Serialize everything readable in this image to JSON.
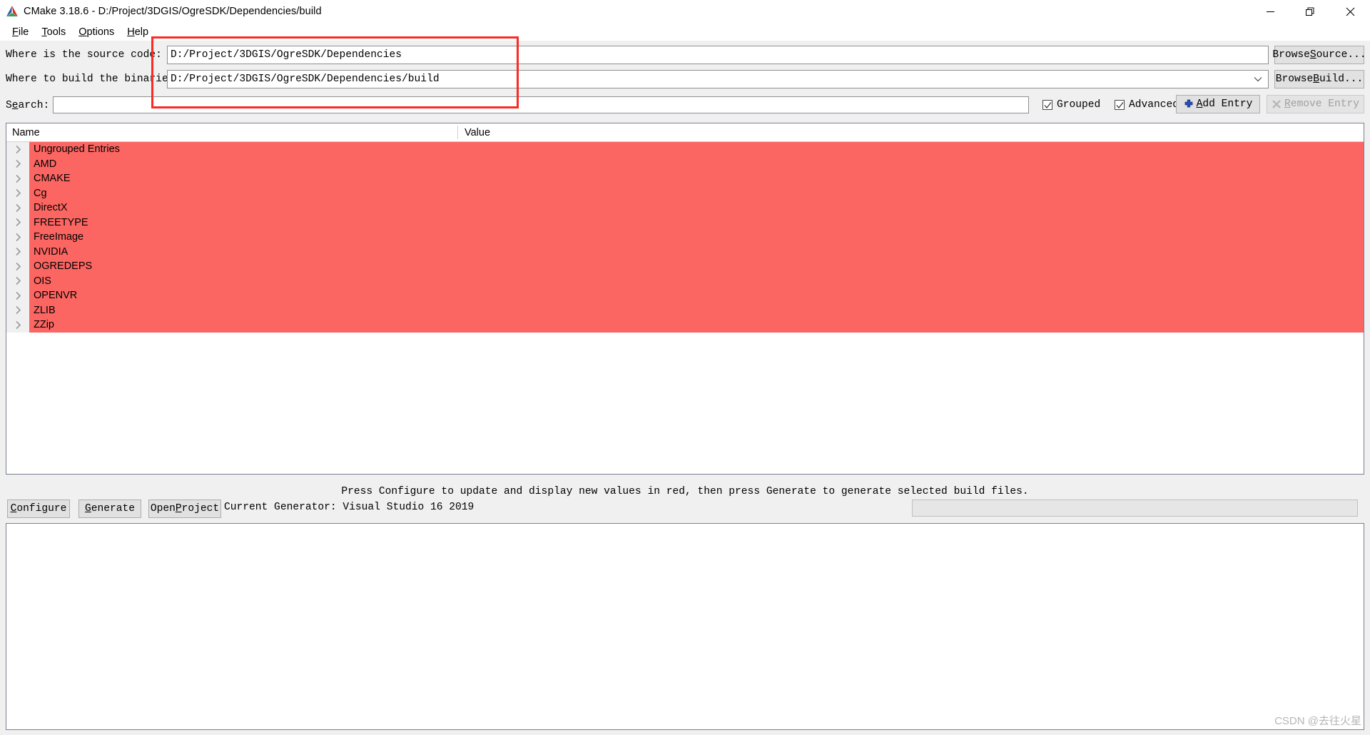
{
  "window": {
    "title": "CMake 3.18.6 - D:/Project/3DGIS/OgreSDK/Dependencies/build",
    "minimize_label": "minimize",
    "restore_label": "restore",
    "close_label": "close"
  },
  "menu": {
    "items": [
      {
        "label": "File",
        "accel": "F",
        "rest": "ile"
      },
      {
        "label": "Tools",
        "accel": "T",
        "rest": "ools"
      },
      {
        "label": "Options",
        "accel": "O",
        "rest": "ptions"
      },
      {
        "label": "Help",
        "accel": "H",
        "rest": "elp"
      }
    ]
  },
  "paths": {
    "source_label": "Where is the source code:",
    "source_value": "D:/Project/3DGIS/OgreSDK/Dependencies",
    "build_label": "Where to build the binaries:",
    "build_value": "D:/Project/3DGIS/OgreSDK/Dependencies/build",
    "browse_source_accel": "S",
    "browse_source_pre": "Browse ",
    "browse_source_post": "ource...",
    "browse_build_accel": "B",
    "browse_build_pre": "Browse ",
    "browse_build_post": "uild..."
  },
  "search": {
    "label_pre": "S",
    "label_accel": "e",
    "label_post": "arch:",
    "value": "",
    "placeholder": ""
  },
  "toolbar": {
    "grouped_label": "Grouped",
    "grouped_checked": true,
    "advanced_label": "Advanced",
    "advanced_checked": true,
    "add_entry_pre": "",
    "add_entry_accel": "A",
    "add_entry_post": "dd Entry",
    "remove_entry_accel": "R",
    "remove_entry_post": "emove Entry",
    "remove_entry_disabled": true
  },
  "tree": {
    "col_name": "Name",
    "col_value": "Value",
    "highlight_color": "#fc6662",
    "rows": [
      {
        "name": "Ungrouped Entries",
        "value": "",
        "expandable": true
      },
      {
        "name": "AMD",
        "value": "",
        "expandable": true
      },
      {
        "name": "CMAKE",
        "value": "",
        "expandable": true
      },
      {
        "name": "Cg",
        "value": "",
        "expandable": true
      },
      {
        "name": "DirectX",
        "value": "",
        "expandable": true
      },
      {
        "name": "FREETYPE",
        "value": "",
        "expandable": true
      },
      {
        "name": "FreeImage",
        "value": "",
        "expandable": true
      },
      {
        "name": "NVIDIA",
        "value": "",
        "expandable": true
      },
      {
        "name": "OGREDEPS",
        "value": "",
        "expandable": true
      },
      {
        "name": "OIS",
        "value": "",
        "expandable": true
      },
      {
        "name": "OPENVR",
        "value": "",
        "expandable": true
      },
      {
        "name": "ZLIB",
        "value": "",
        "expandable": true
      },
      {
        "name": "ZZip",
        "value": "",
        "expandable": true
      }
    ]
  },
  "status": {
    "message": "Press Configure to update and display new values in red, then press Generate to generate selected build files.",
    "generator_text": "Current Generator: Visual Studio 16 2019",
    "progress_percent": 0
  },
  "actions": {
    "configure_accel": "C",
    "configure_post": "onfigure",
    "generate_accel": "G",
    "generate_post": "enerate",
    "open_project_pre": "Open ",
    "open_project_accel": "P",
    "open_project_post": "roject"
  },
  "output": {
    "text": ""
  },
  "watermark": {
    "text": "CSDN @去往火星"
  }
}
